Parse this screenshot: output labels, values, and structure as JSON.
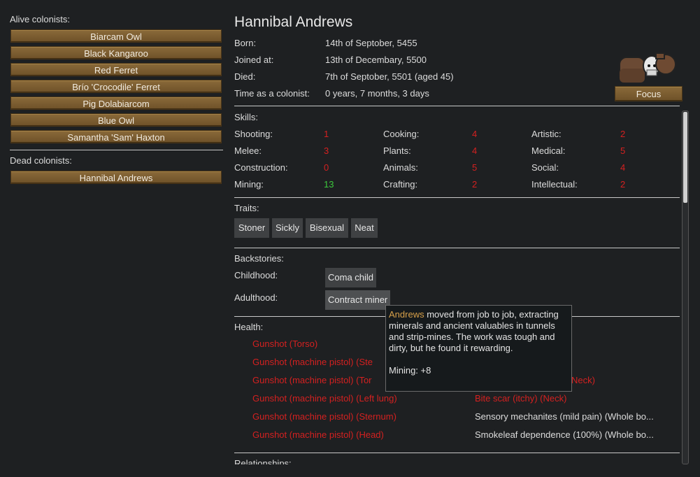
{
  "sidebar": {
    "alive_header": "Alive colonists:",
    "alive": [
      "Biarcam Owl",
      "Black Kangaroo",
      "Red Ferret",
      "Brío 'Crocodile' Ferret",
      "Pig Dolabiarcom",
      "Blue Owl",
      "Samantha 'Sam' Haxton"
    ],
    "dead_header": "Dead colonists:",
    "dead": [
      "Hannibal Andrews"
    ]
  },
  "colonist": {
    "name": "Hannibal Andrews",
    "born_label": "Born:",
    "born": "14th of Septober, 5455",
    "joined_label": "Joined at:",
    "joined": "13th of Decembary, 5500",
    "died_label": "Died:",
    "died": "7th of Septober, 5501 (aged 45)",
    "time_label": "Time as a colonist:",
    "time": "0 years, 7 months, 3 days",
    "focus_label": "Focus"
  },
  "skills": {
    "header": "Skills:",
    "items": [
      {
        "name": "Shooting:",
        "value": "1",
        "color": "#d42020"
      },
      {
        "name": "Cooking:",
        "value": "4",
        "color": "#d42020"
      },
      {
        "name": "Artistic:",
        "value": "2",
        "color": "#d42020"
      },
      {
        "name": "Melee:",
        "value": "3",
        "color": "#d42020"
      },
      {
        "name": "Plants:",
        "value": "4",
        "color": "#d42020"
      },
      {
        "name": "Medical:",
        "value": "5",
        "color": "#d42020"
      },
      {
        "name": "Construction:",
        "value": "0",
        "color": "#d42020"
      },
      {
        "name": "Animals:",
        "value": "5",
        "color": "#d42020"
      },
      {
        "name": "Social:",
        "value": "4",
        "color": "#d42020"
      },
      {
        "name": "Mining:",
        "value": "13",
        "color": "#3cc83c"
      },
      {
        "name": "Crafting:",
        "value": "2",
        "color": "#d42020"
      },
      {
        "name": "Intellectual:",
        "value": "2",
        "color": "#d42020"
      }
    ]
  },
  "traits": {
    "header": "Traits:",
    "items": [
      "Stoner",
      "Sickly",
      "Bisexual",
      "Neat"
    ]
  },
  "backstories": {
    "header": "Backstories:",
    "childhood_label": "Childhood:",
    "childhood": "Coma child",
    "adulthood_label": "Adulthood:",
    "adulthood": "Contract miner"
  },
  "health": {
    "header": "Health:",
    "left": [
      "Gunshot (Torso)",
      "Gunshot (machine pistol) (Ste",
      "Gunshot (machine pistol) (Tor",
      "Gunshot (machine pistol) (Left lung)",
      "Gunshot (machine pistol) (Sternum)",
      "Gunshot (machine pistol) (Head)"
    ],
    "right_partial": "Neck)",
    "right": [
      "Bite scar (itchy) (Neck)",
      "Sensory mechanites (mild pain) (Whole bo...",
      "Smokeleaf dependence (100%) (Whole bo..."
    ]
  },
  "relationships_header": "Relationships:",
  "tooltip": {
    "name": "Andrews",
    "text": " moved from job to job, extracting minerals and ancient valuables in tunnels and strip-mines. The work was tough and dirty, but he found it rewarding.",
    "bonus": "Mining: +8"
  },
  "colors": {
    "accent": "#d7a04a",
    "bad": "#d42020",
    "good": "#3cc83c",
    "wood": "#7a5c30"
  }
}
